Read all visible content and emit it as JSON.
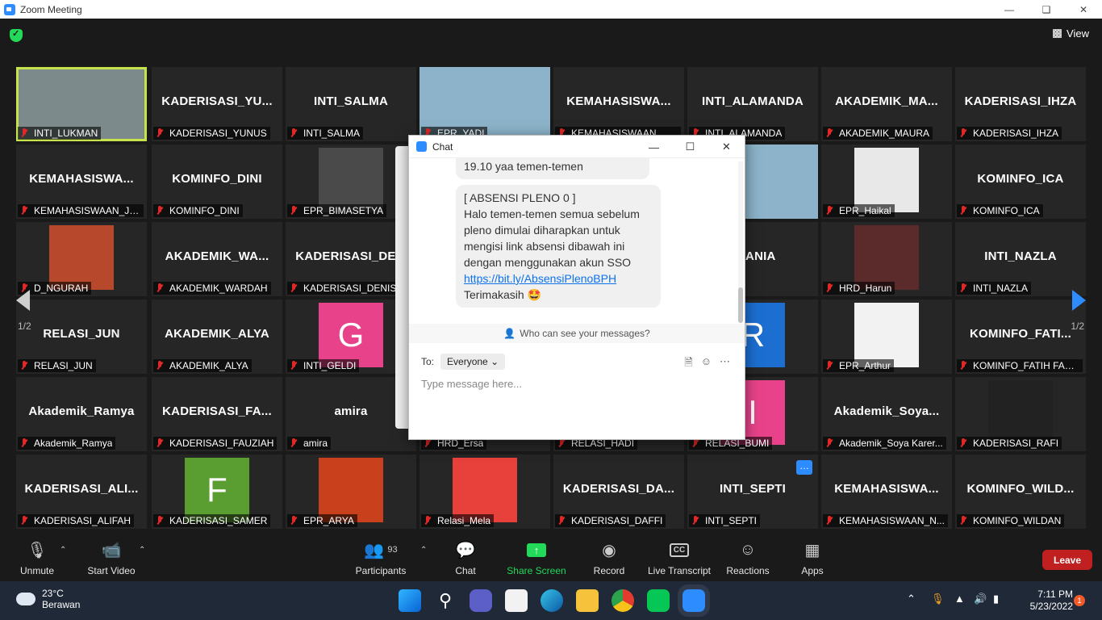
{
  "window": {
    "title": "Zoom Meeting"
  },
  "header": {
    "view_label": "View"
  },
  "pagination": {
    "left": "1/2",
    "right": "1/2"
  },
  "tiles": [
    {
      "big": "",
      "label": "INTI_LUKMAN",
      "type": "video",
      "color": "#7d8a8c",
      "active": true
    },
    {
      "big": "KADERISASI_YU...",
      "label": "KADERISASI_YUNUS"
    },
    {
      "big": "INTI_SALMA",
      "label": "INTI_SALMA"
    },
    {
      "big": "",
      "label": "EPR_YADI",
      "type": "video",
      "color": "#8cb3c9"
    },
    {
      "big": "KEMAHASISWA...",
      "label": "KEMAHASISWAAN_RA..."
    },
    {
      "big": "INTI_ALAMANDA",
      "label": "INTI_ALAMANDA"
    },
    {
      "big": "AKADEMIK_MA...",
      "label": "AKADEMIK_MAURA"
    },
    {
      "big": "KADERISASI_IHZA",
      "label": "KADERISASI_IHZA"
    },
    {
      "big": "KEMAHASISWA...",
      "label": "KEMAHASISWAAN_JIZ..."
    },
    {
      "big": "KOMINFO_DINI",
      "label": "KOMINFO_DINI"
    },
    {
      "big": "",
      "label": "EPR_BIMASETYA",
      "type": "avatar",
      "color": "#4a4a4a",
      "glyph": ""
    },
    {
      "big": "",
      "label": "",
      "type": "avatar",
      "color": "#3a3a3a",
      "glyph": ""
    },
    {
      "big": "",
      "label": "",
      "type": "avatar",
      "color": "#3a3a3a",
      "glyph": ""
    },
    {
      "big": "",
      "label": "N",
      "type": "video",
      "color": "#8cb3c9"
    },
    {
      "big": "",
      "label": "EPR_Haikal",
      "type": "avatar",
      "color": "#e8e8e8",
      "glyph": ""
    },
    {
      "big": "KOMINFO_ICA",
      "label": "KOMINFO_ICA"
    },
    {
      "big": "",
      "label": "D_NGURAH",
      "type": "avatar",
      "color": "#b8482c",
      "glyph": ""
    },
    {
      "big": "AKADEMIK_WA...",
      "label": "AKADEMIK_WARDAH"
    },
    {
      "big": "KADERISASI_DE...",
      "label": "KADERISASI_DENISA"
    },
    {
      "big": "",
      "label": "",
      "type": "plain"
    },
    {
      "big": "",
      "label": "",
      "type": "plain"
    },
    {
      "big": "TSANIA",
      "label": "NIA"
    },
    {
      "big": "",
      "label": "HRD_Harun",
      "type": "avatar",
      "color": "#5b2a2a",
      "glyph": ""
    },
    {
      "big": "INTI_NAZLA",
      "label": "INTI_NAZLA"
    },
    {
      "big": "RELASI_JUN",
      "label": "RELASI_JUN"
    },
    {
      "big": "AKADEMIK_ALYA",
      "label": "AKADEMIK_ALYA"
    },
    {
      "big": "",
      "label": "INTI_GELDI",
      "type": "avatar",
      "color": "#e8438a",
      "glyph": "G"
    },
    {
      "big": "",
      "label": "",
      "type": "plain"
    },
    {
      "big": "",
      "label": "",
      "type": "plain"
    },
    {
      "big": "",
      "label": "ASI_NIA",
      "type": "avatar",
      "color": "#1c6fd1",
      "glyph": "R"
    },
    {
      "big": "",
      "label": "EPR_Arthur",
      "type": "avatar",
      "color": "#f2f2f2",
      "glyph": ""
    },
    {
      "big": "KOMINFO_FATI...",
      "label": "KOMINFO_FATIH FAD..."
    },
    {
      "big": "Akademik_Ramya",
      "label": "Akademik_Ramya"
    },
    {
      "big": "KADERISASI_FA...",
      "label": "KADERISASI_FAUZIAH"
    },
    {
      "big": "amira",
      "label": "amira"
    },
    {
      "big": "",
      "label": "HRD_Ersa",
      "type": "plain"
    },
    {
      "big": "",
      "label": "RELASI_HADI",
      "type": "plain"
    },
    {
      "big": "",
      "label": "RELASI_BUMI",
      "type": "avatar",
      "color": "#e8438a",
      "glyph": "I"
    },
    {
      "big": "Akademik_Soya...",
      "label": "Akademik_Soya Karer..."
    },
    {
      "big": "",
      "label": "KADERISASI_RAFI",
      "type": "avatar",
      "color": "#222222",
      "glyph": ""
    },
    {
      "big": "KADERISASI_ALI...",
      "label": "KADERISASI_ALIFAH"
    },
    {
      "big": "",
      "label": "KADERISASI_SAMER",
      "type": "avatar",
      "color": "#5a9e32",
      "glyph": "F"
    },
    {
      "big": "",
      "label": "EPR_ARYA",
      "type": "avatar",
      "color": "#c8411c",
      "glyph": ""
    },
    {
      "big": "",
      "label": "Relasi_Mela",
      "type": "avatar",
      "color": "#e8403a",
      "glyph": ""
    },
    {
      "big": "KADERISASI_DA...",
      "label": "KADERISASI_DAFFI"
    },
    {
      "big": "INTI_SEPTI",
      "label": "INTI_SEPTI"
    },
    {
      "big": "KEMAHASISWA...",
      "label": "KEMAHASISWAAN_N..."
    },
    {
      "big": "KOMINFO_WILD...",
      "label": "KOMINFO_WILDAN"
    }
  ],
  "chat": {
    "title": "Chat",
    "msg1": "19.10 yaa temen-temen",
    "msg2_line1": "[ ABSENSI PLENO 0 ]",
    "msg2_line2": "Halo temen-temen semua sebelum",
    "msg2_line3": "pleno dimulai diharapkan untuk",
    "msg2_line4": "mengisi link absensi dibawah ini",
    "msg2_line5": "dengan menggunakan akun SSO",
    "msg2_link": "https://bit.ly/AbsensiPlenoBPH",
    "msg2_line7": "Terimakasih 🤩",
    "who_can_see": "Who can see your messages?",
    "to_label": "To:",
    "to_value": "Everyone",
    "compose_placeholder": "Type message here..."
  },
  "toolbar": {
    "unmute": "Unmute",
    "start_video": "Start Video",
    "participants": "Participants",
    "participants_count": "93",
    "chat": "Chat",
    "share_screen": "Share Screen",
    "record": "Record",
    "live_transcript": "Live Transcript",
    "reactions": "Reactions",
    "apps": "Apps",
    "leave": "Leave",
    "cc": "CC"
  },
  "taskbar": {
    "temp": "23°C",
    "weather": "Berawan",
    "time": "7:11 PM",
    "date": "5/23/2022",
    "notifications": "1"
  }
}
